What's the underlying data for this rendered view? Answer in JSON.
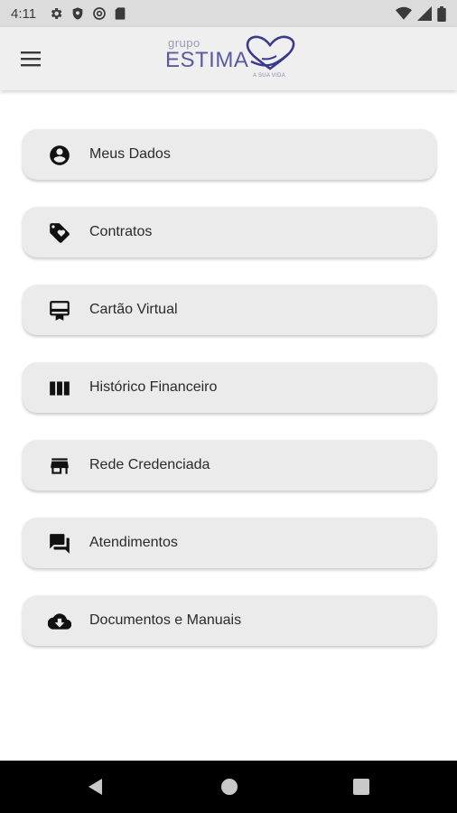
{
  "status_bar": {
    "time": "4:11",
    "left_icons": [
      "settings-icon",
      "shield-icon",
      "at-sign-icon",
      "sd-card-icon"
    ],
    "right_icons": [
      "wifi-icon",
      "signal-icon",
      "battery-icon"
    ]
  },
  "app_bar": {
    "logo_grupo": "grupo",
    "logo_estima": "ESTIMA",
    "logo_subtitle": "A SUA VIDA",
    "logo_color": "#3a3a8c"
  },
  "menu": {
    "items": [
      {
        "label": "Meus Dados",
        "icon": "account-circle-icon"
      },
      {
        "label": "Contratos",
        "icon": "tag-icon"
      },
      {
        "label": "Cartão Virtual",
        "icon": "card-membership-icon"
      },
      {
        "label": "Histórico Financeiro",
        "icon": "columns-icon"
      },
      {
        "label": "Rede Credenciada",
        "icon": "store-icon"
      },
      {
        "label": "Atendimentos",
        "icon": "forum-icon"
      },
      {
        "label": "Documentos e Manuais",
        "icon": "cloud-download-icon"
      }
    ]
  },
  "nav_bar": {
    "buttons": [
      "back-icon",
      "home-icon",
      "recents-icon"
    ]
  }
}
